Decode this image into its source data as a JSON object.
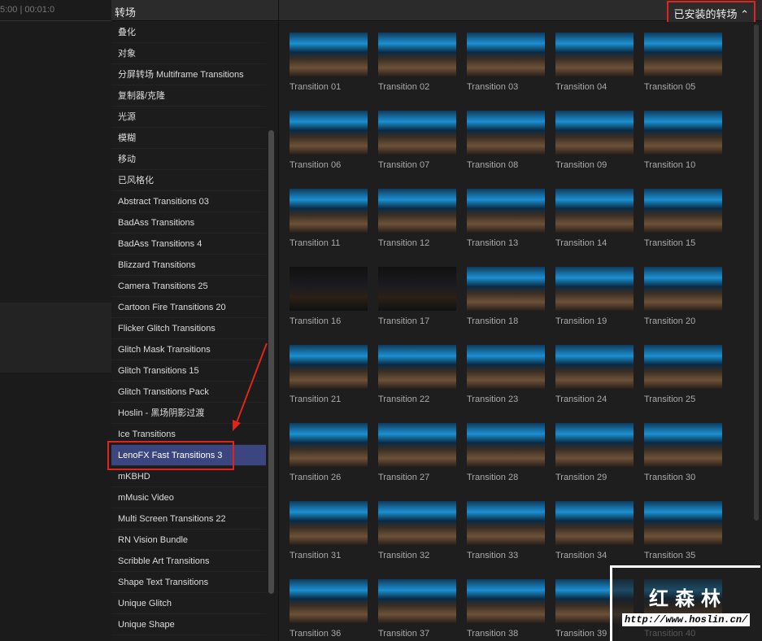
{
  "timeline": {
    "ruler": "5:00          |   00:01:0"
  },
  "header": {
    "title": "转场",
    "selector": "已安装的转场 ⌃"
  },
  "sidebar": {
    "items": [
      "叠化",
      "对象",
      "分屏转场 Multiframe Transitions",
      "复制器/克隆",
      "光源",
      "模糊",
      "移动",
      "已风格化",
      "Abstract Transitions 03",
      "BadAss Transitions",
      "BadAss Transitions 4",
      "Blizzard Transitions",
      "Camera Transitions 25",
      "Cartoon Fire Transitions 20",
      "Flicker Glitch Transitions",
      "Glitch Mask Transitions",
      "Glitch Transitions 15",
      "Glitch Transitions Pack",
      "Hoslin - 黑场阴影过渡",
      "Ice Transitions",
      "LenoFX Fast Transitions 3",
      "mKBHD",
      "mMusic Video",
      "Multi Screen Transitions 22",
      "RN Vision Bundle",
      "Scribble Art Transitions",
      "Shape Text Transitions",
      "Unique Glitch",
      "Unique Shape"
    ],
    "selected_index": 20
  },
  "grid": {
    "items": [
      "Transition 01",
      "Transition 02",
      "Transition 03",
      "Transition 04",
      "Transition 05",
      "Transition 06",
      "Transition 07",
      "Transition 08",
      "Transition 09",
      "Transition 10",
      "Transition 11",
      "Transition 12",
      "Transition 13",
      "Transition 14",
      "Transition 15",
      "Transition 16",
      "Transition 17",
      "Transition 18",
      "Transition 19",
      "Transition 20",
      "Transition 21",
      "Transition 22",
      "Transition 23",
      "Transition 24",
      "Transition 25",
      "Transition 26",
      "Transition 27",
      "Transition 28",
      "Transition 29",
      "Transition 30",
      "Transition 31",
      "Transition 32",
      "Transition 33",
      "Transition 34",
      "Transition 35",
      "Transition 36",
      "Transition 37",
      "Transition 38",
      "Transition 39",
      "Transition 40"
    ]
  },
  "watermark": {
    "name": "红森林",
    "url": "http://www.hoslin.cn/"
  },
  "colors": {
    "accent": "#3b4680",
    "annotation": "#e0241b"
  }
}
